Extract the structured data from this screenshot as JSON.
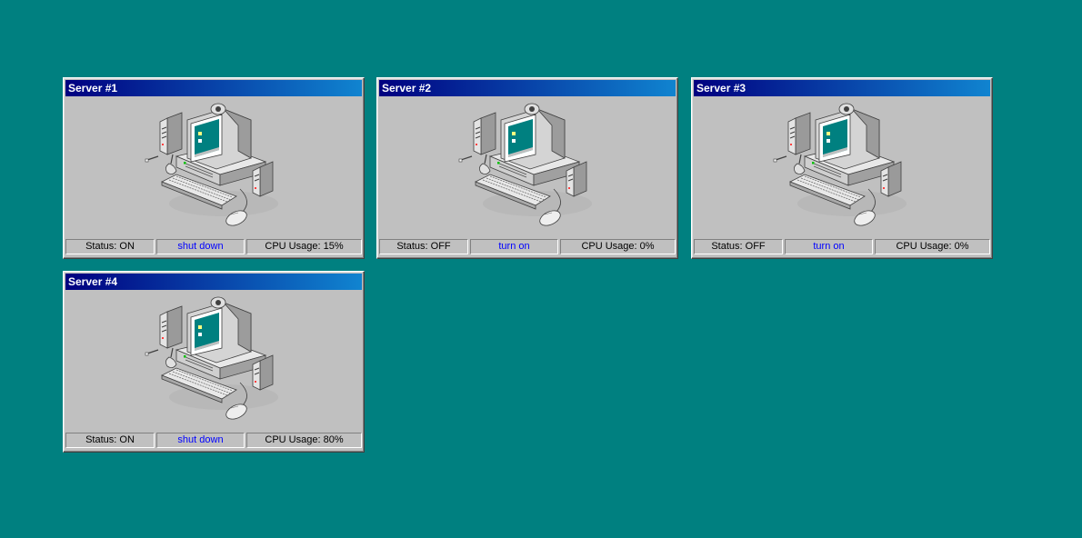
{
  "servers": [
    {
      "title": "Server #1",
      "status": "Status: ON",
      "action": "shut down",
      "cpu": "CPU Usage: 15%"
    },
    {
      "title": "Server #2",
      "status": "Status: OFF",
      "action": "turn on",
      "cpu": "CPU Usage: 0%"
    },
    {
      "title": "Server #3",
      "status": "Status: OFF",
      "action": "turn on",
      "cpu": "CPU Usage: 0%"
    },
    {
      "title": "Server #4",
      "status": "Status: ON",
      "action": "shut down",
      "cpu": "CPU Usage: 80%"
    }
  ],
  "icons": {
    "computer": "computer-icon"
  },
  "colors": {
    "desktop": "#008080",
    "title_start": "#000080",
    "title_end": "#1084d0",
    "window": "#c0c0c0",
    "link": "#0000ff",
    "screen": "#008080"
  }
}
